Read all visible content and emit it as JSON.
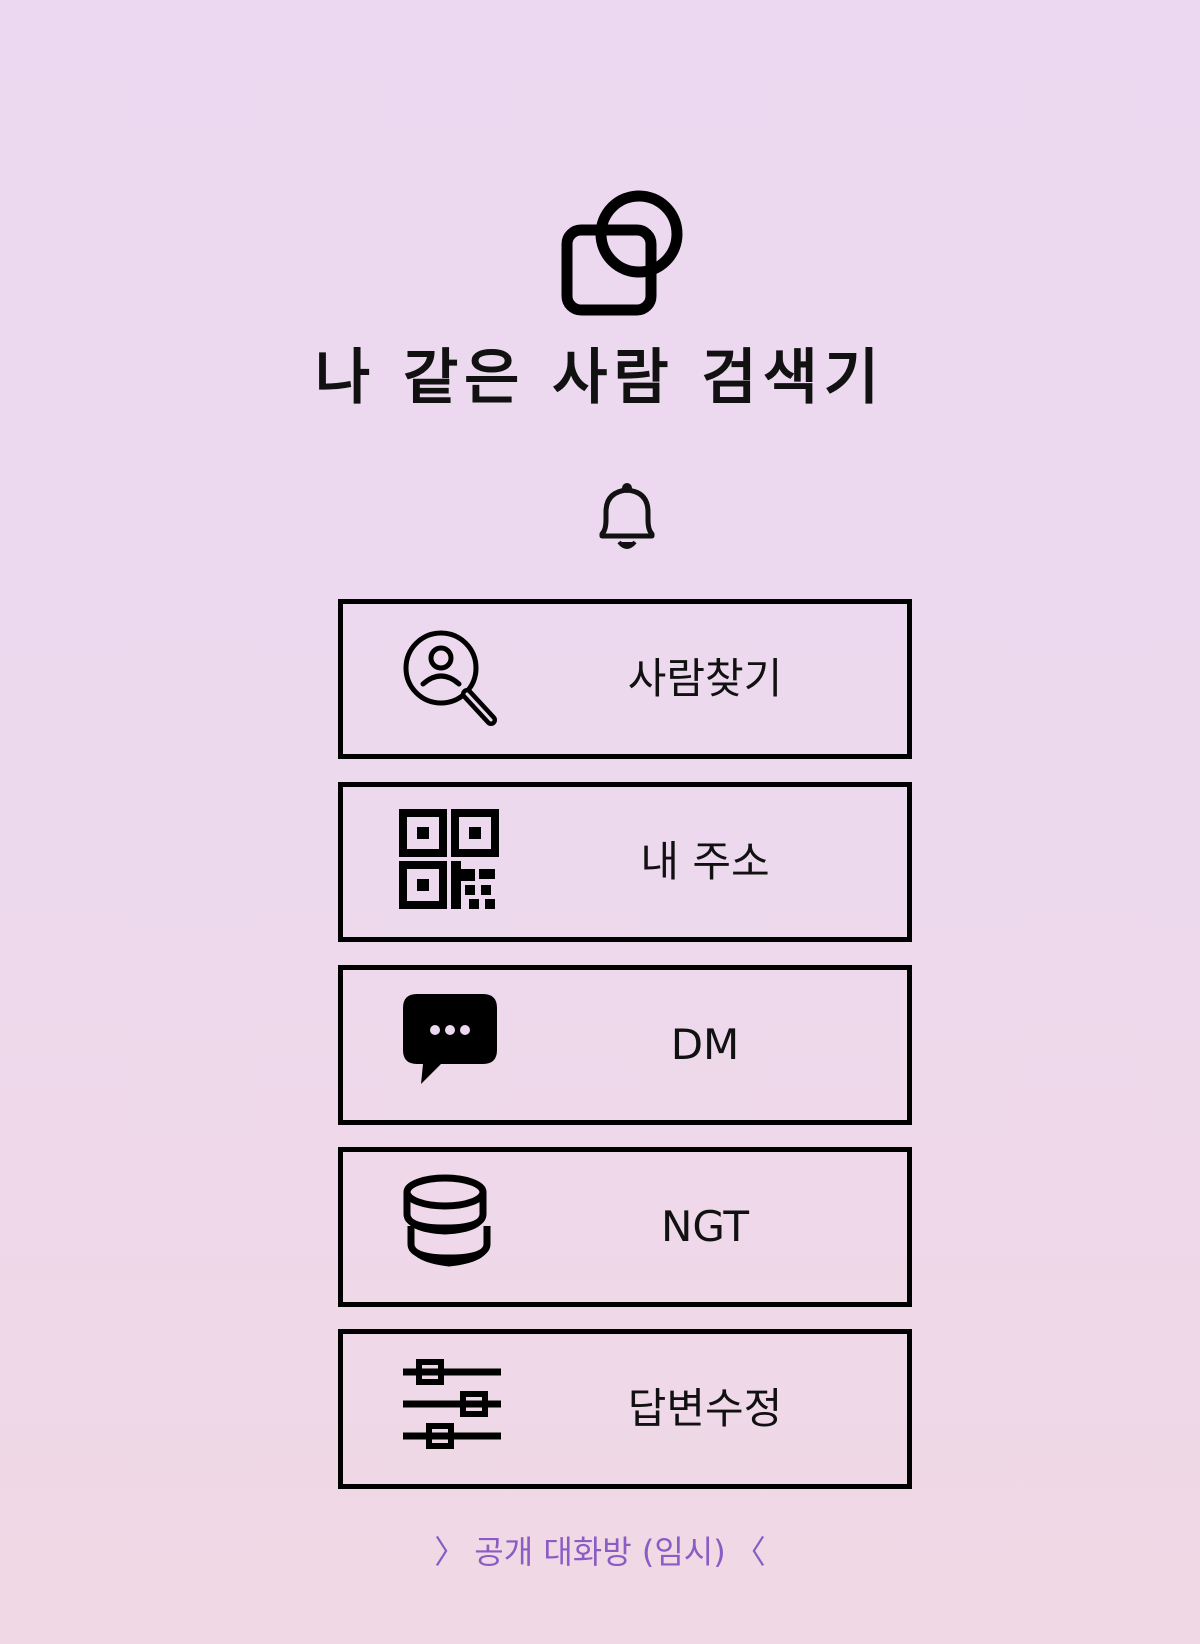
{
  "app": {
    "title": "나 같은 사람 검색기",
    "logo_icon": "overlapping-square-circle-icon",
    "bell_icon": "bell-icon"
  },
  "menu": {
    "items": [
      {
        "label": "사람찾기",
        "icon": "person-search-icon"
      },
      {
        "label": "내 주소",
        "icon": "qr-code-icon"
      },
      {
        "label": "DM",
        "icon": "chat-bubble-icon"
      },
      {
        "label": "NGT",
        "icon": "coin-stack-icon"
      },
      {
        "label": "답변수정",
        "icon": "sliders-icon"
      }
    ]
  },
  "footer": {
    "link_text": "공개 대화방 (임시)",
    "left_chevron": "〉",
    "right_chevron": "〈",
    "color": "#8a5cc4"
  }
}
